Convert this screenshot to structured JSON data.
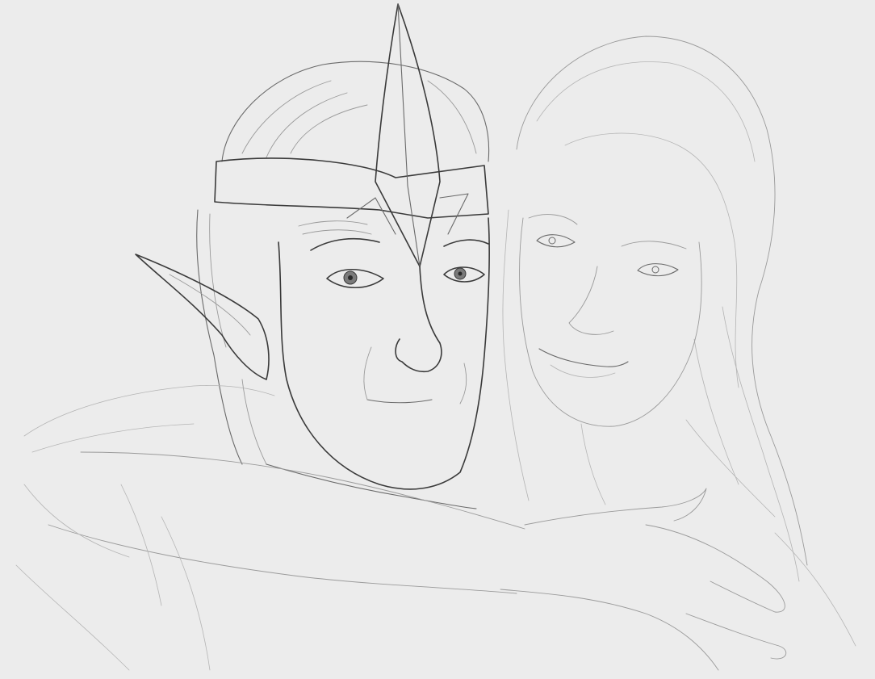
{
  "image": {
    "background_color": "#ececec",
    "line_color": "#3a3a3a",
    "subjects": [
      "elf-man-with-circlet",
      "woman-with-long-hair"
    ],
    "medium": "pencil-sketch"
  }
}
